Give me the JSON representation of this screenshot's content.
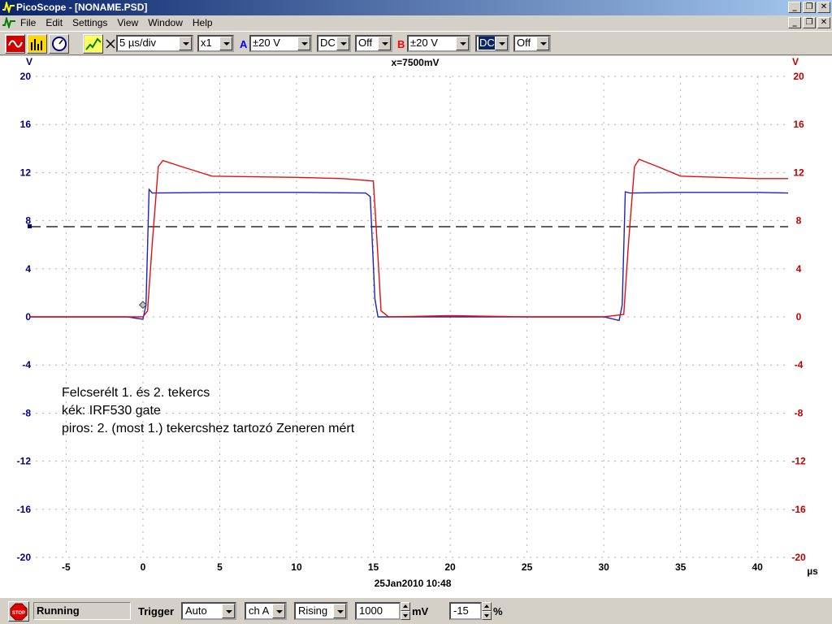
{
  "window": {
    "title": "PicoScope - [NONAME.PSD]",
    "controls": [
      "_",
      "❐",
      "✕"
    ]
  },
  "menu": {
    "items": [
      "File",
      "Edit",
      "Settings",
      "View",
      "Window",
      "Help"
    ]
  },
  "toolbar": {
    "timebase": "5 µs/div",
    "multiplier": "x1",
    "channel_a": {
      "label": "A",
      "range": "±20 V",
      "coupling": "DC",
      "filter": "Off",
      "color": "#0000ff"
    },
    "channel_b": {
      "label": "B",
      "range": "±20 V",
      "coupling": "DC",
      "filter": "Off",
      "color": "#ff0000"
    }
  },
  "plot": {
    "left_axis_unit": "V",
    "right_axis_unit": "V",
    "x_axis_unit": "µs",
    "threshold_readout": "x=7500mV",
    "datetime": "25Jan2010  10:48",
    "annotation_lines": [
      "Felcserélt 1. és 2. tekercs",
      "kék: IRF530 gate",
      "piros: 2. (most 1.) tekercshez tartozó Zeneren mért"
    ]
  },
  "chart_data": {
    "type": "line",
    "x_ticks": [
      -5,
      0,
      5,
      10,
      15,
      20,
      25,
      30,
      35,
      40
    ],
    "y_ticks": [
      20,
      16,
      12,
      8,
      4,
      0,
      -4,
      -8,
      -12,
      -16,
      -20
    ],
    "xlim": [
      -7.4,
      42
    ],
    "ylim": [
      -20,
      20
    ],
    "threshold": 7.5,
    "trigger_point": [
      0,
      1
    ],
    "axis_colors": {
      "left": "#000080",
      "right": "#c00000"
    },
    "series": [
      {
        "color": "#2020c0",
        "points": [
          [
            -7.4,
            0
          ],
          [
            -1,
            0
          ],
          [
            0,
            -0.2
          ],
          [
            0.2,
            1
          ],
          [
            0.4,
            10.6
          ],
          [
            0.6,
            10.3
          ],
          [
            5,
            10.35
          ],
          [
            10,
            10.35
          ],
          [
            14.5,
            10.3
          ],
          [
            14.8,
            10
          ],
          [
            15.1,
            1.5
          ],
          [
            15.3,
            0
          ],
          [
            20,
            0
          ],
          [
            25,
            0
          ],
          [
            30,
            0
          ],
          [
            31,
            -0.3
          ],
          [
            31.2,
            1
          ],
          [
            31.4,
            10.4
          ],
          [
            31.7,
            10.3
          ],
          [
            35,
            10.35
          ],
          [
            40,
            10.35
          ],
          [
            42,
            10.3
          ]
        ]
      },
      {
        "color": "#e01010",
        "points": [
          [
            -7.4,
            0
          ],
          [
            0,
            0
          ],
          [
            0.3,
            0.5
          ],
          [
            0.6,
            6
          ],
          [
            1,
            12.5
          ],
          [
            1.3,
            13
          ],
          [
            2.5,
            12.5
          ],
          [
            4.5,
            11.7
          ],
          [
            10,
            11.6
          ],
          [
            13,
            11.5
          ],
          [
            15,
            11.3
          ],
          [
            15.3,
            5
          ],
          [
            15.5,
            0.5
          ],
          [
            16,
            0
          ],
          [
            20,
            0.1
          ],
          [
            25,
            0
          ],
          [
            30,
            0
          ],
          [
            31.3,
            0.2
          ],
          [
            31.6,
            6
          ],
          [
            32,
            12.5
          ],
          [
            32.3,
            13.1
          ],
          [
            33.5,
            12.5
          ],
          [
            35,
            11.7
          ],
          [
            40,
            11.5
          ],
          [
            42,
            11.5
          ]
        ]
      }
    ]
  },
  "status": {
    "stop_label": "STOP",
    "state": "Running",
    "trigger_label": "Trigger",
    "trigger_mode": "Auto",
    "trigger_channel": "ch A",
    "trigger_edge": "Rising",
    "trigger_level": "1000",
    "trigger_level_unit": "mV",
    "pretrigger": "-15",
    "pretrigger_unit": "%"
  }
}
